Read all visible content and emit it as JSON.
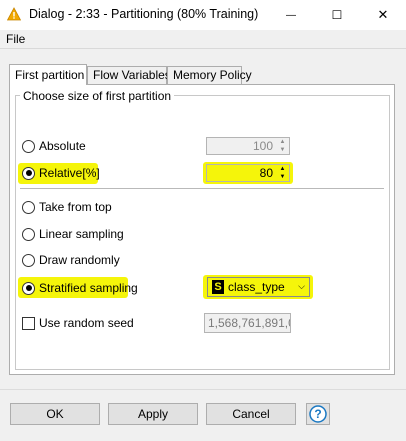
{
  "window": {
    "title": "Dialog - 2:33 - Partitioning (80% Training)",
    "icon": "warning-icon",
    "minimize": "—",
    "maximize": "☐",
    "close": "✕"
  },
  "menu": {
    "file": "File"
  },
  "tabs": [
    {
      "label": "First partition",
      "active": true
    },
    {
      "label": "Flow Variables",
      "active": false
    },
    {
      "label": "Memory Policy",
      "active": false
    }
  ],
  "group": {
    "title": "Choose size of first partition"
  },
  "size_options": {
    "absolute": {
      "label": "Absolute",
      "value": "100",
      "selected": false
    },
    "relative": {
      "label": "Relative[%]",
      "value": "80",
      "selected": true
    }
  },
  "sampling_options": [
    {
      "label": "Take from top",
      "selected": false
    },
    {
      "label": "Linear sampling",
      "selected": false
    },
    {
      "label": "Draw randomly",
      "selected": false
    },
    {
      "label": "Stratified sampling",
      "selected": true
    }
  ],
  "stratified_column": {
    "type_badge": "S",
    "value": "class_type"
  },
  "random_seed": {
    "label": "Use random seed",
    "checked": false,
    "value": "1,568,761,891,0"
  },
  "buttons": {
    "ok": "OK",
    "apply": "Apply",
    "cancel": "Cancel",
    "help": "?"
  },
  "colors": {
    "highlight": "#f5f50a",
    "help_accent": "#1a78c2"
  }
}
